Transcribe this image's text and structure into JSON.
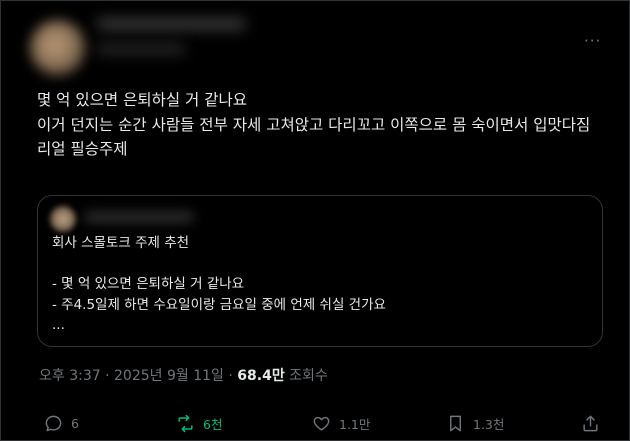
{
  "author": {
    "avatar_blurred": true,
    "name_blurred": true
  },
  "menu_icon": "more-horizontal-icon",
  "post": {
    "text": "몇 억 있으면 은퇴하실 거 같나요\n이거 던지는 순간 사람들 전부 자세 고쳐앉고 다리꼬고 이쪽으로 몸 숙이면서 입맛다짐\n리얼 필승주제"
  },
  "quote": {
    "author_blurred": true,
    "text": "회사 스몰토크 주제 추천\n\n- 몇 억 있으면 은퇴하실 거 같나요\n- 주4.5일제 하면 수요일이랑 금요일 중에 언제 쉬실 건가요\n..."
  },
  "meta": {
    "time": "오후 3:37",
    "sep1": "·",
    "date": "2025년 9월 11일",
    "sep2": "·",
    "views": "68.4만",
    "views_label": "조회수"
  },
  "actions": {
    "reply": {
      "icon": "reply-icon",
      "count": "6"
    },
    "repost": {
      "icon": "repost-icon",
      "count": "6천",
      "color": "#00ba7c"
    },
    "like": {
      "icon": "heart-icon",
      "count": "1.1만"
    },
    "bookmark": {
      "icon": "bookmark-icon",
      "count": "1.3천"
    },
    "share": {
      "icon": "share-icon"
    }
  },
  "colors": {
    "background": "#000000",
    "text": "#e7e9ea",
    "muted": "#71767b",
    "border": "#2f3336"
  }
}
